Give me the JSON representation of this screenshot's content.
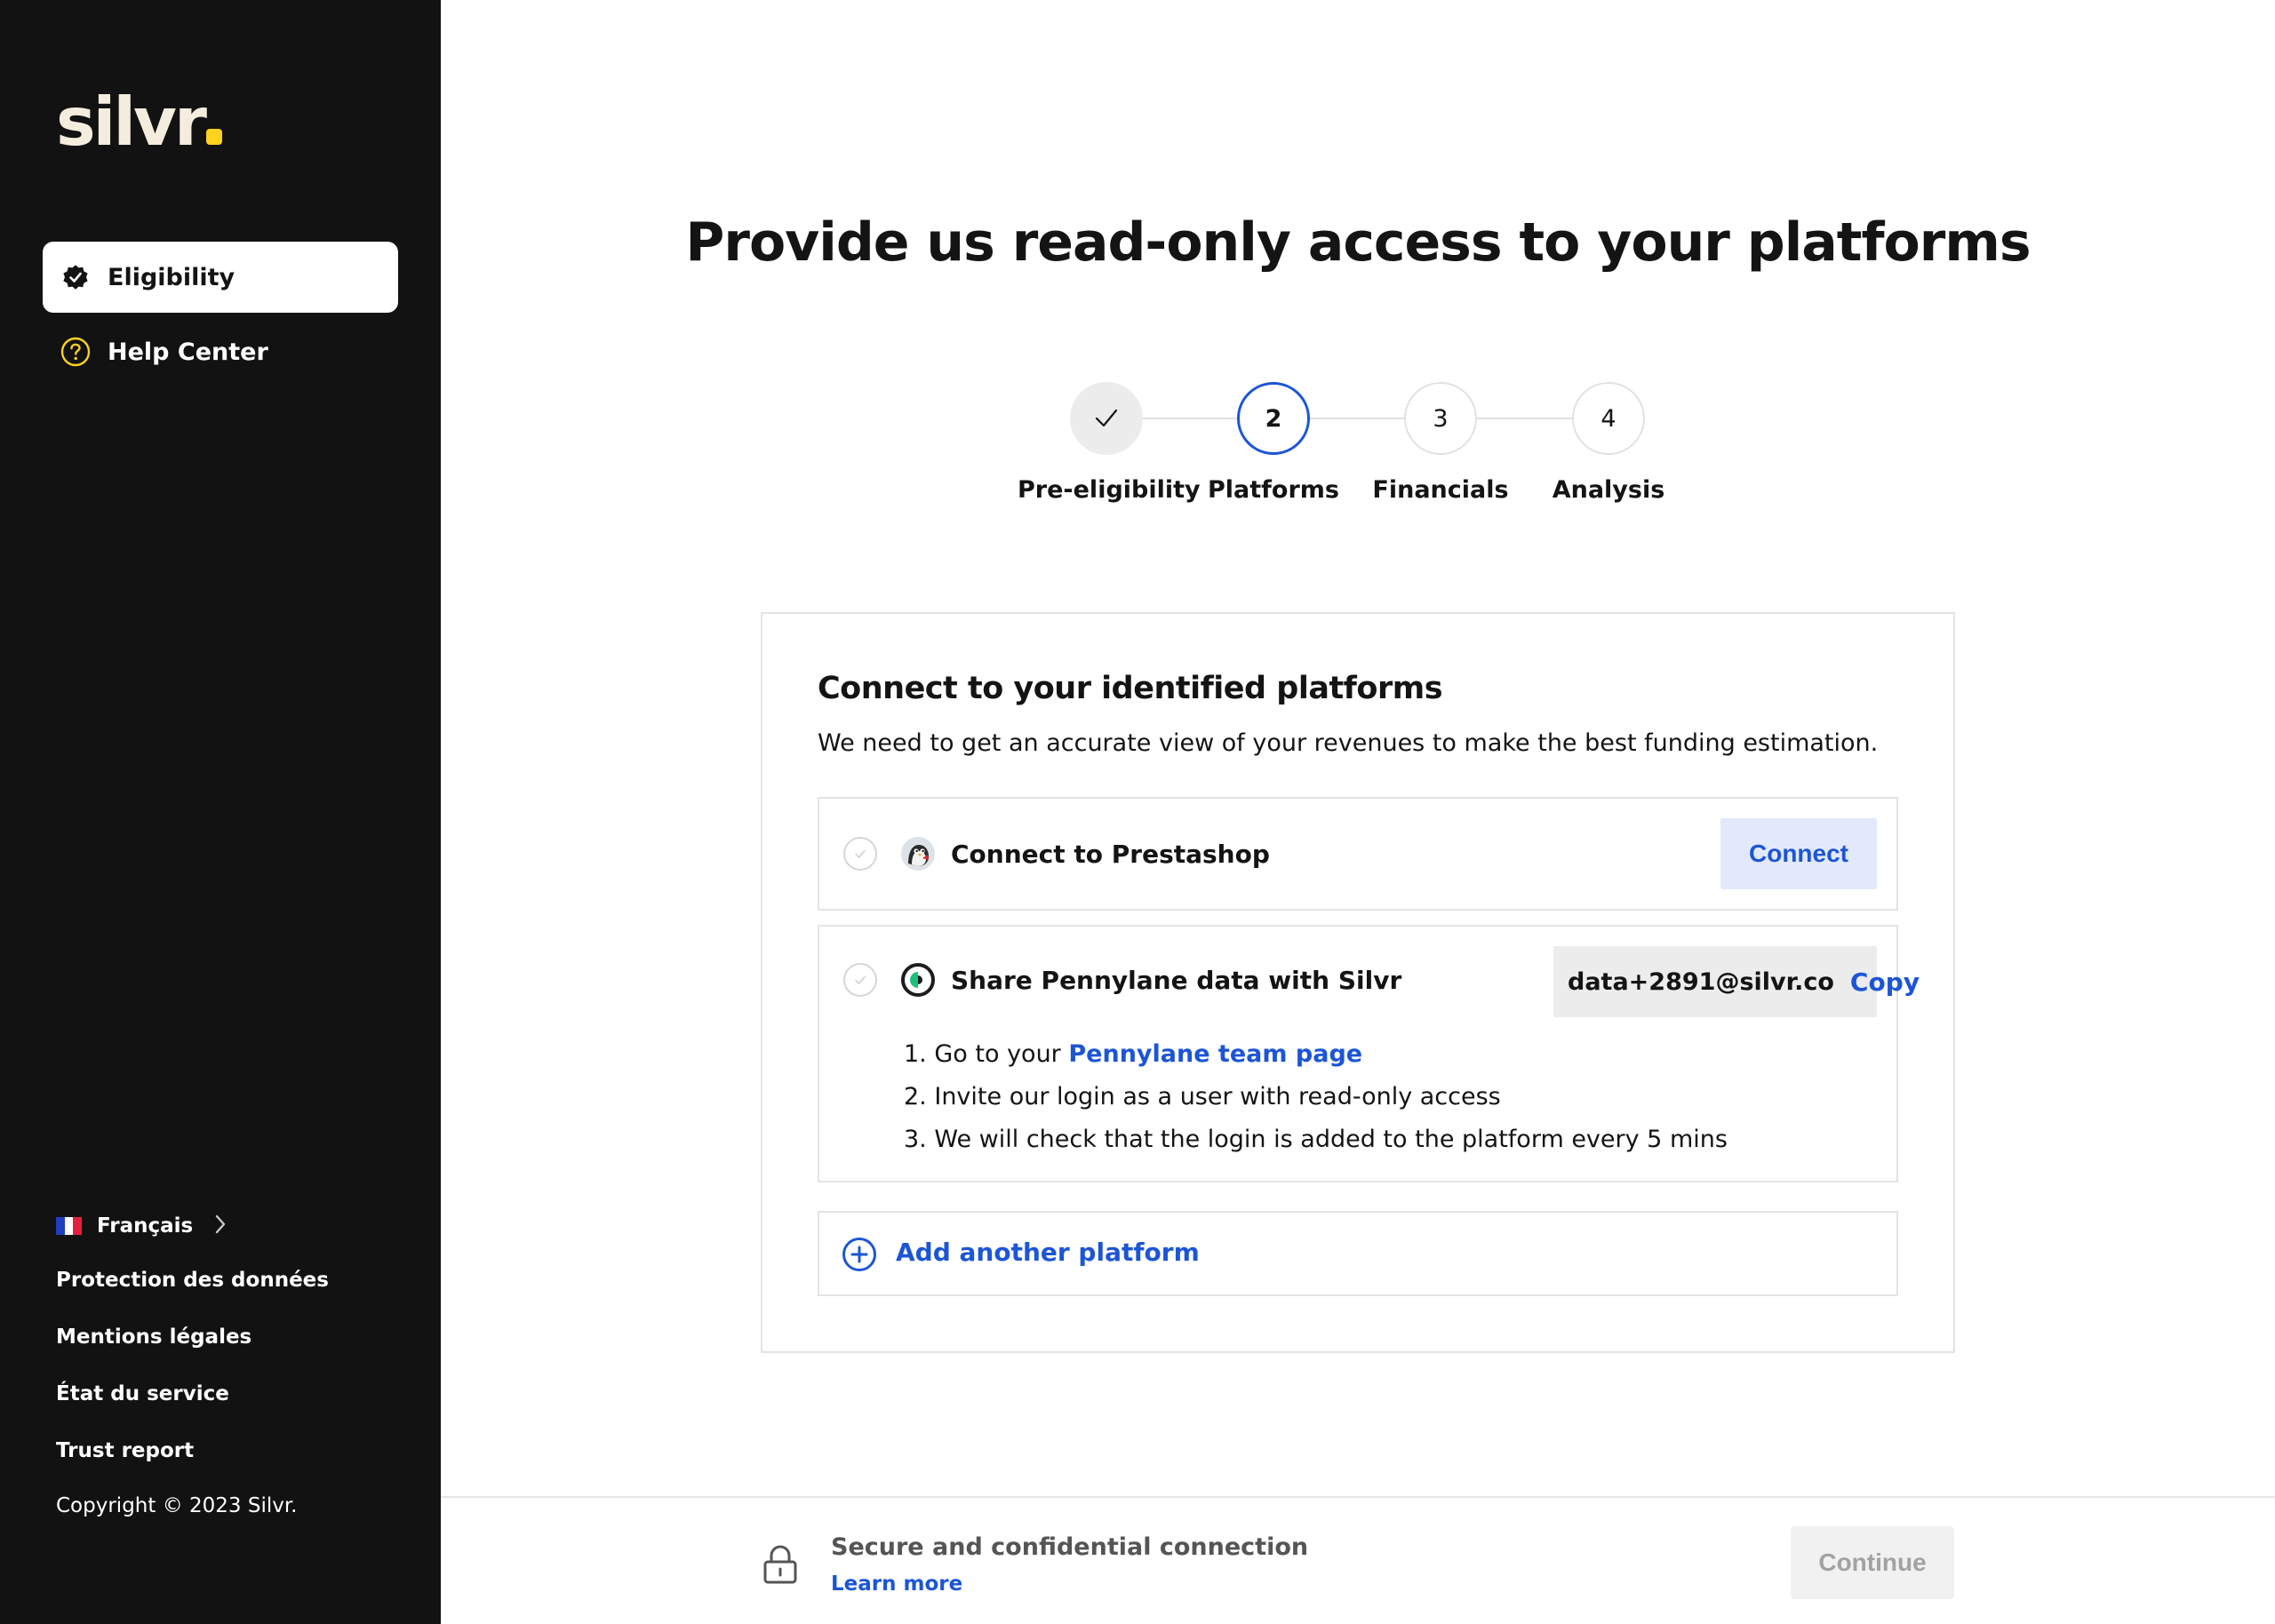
{
  "brand": {
    "logo_text": "silvr",
    "accent_color": "#ffd21f",
    "sidebar_bg": "#121212",
    "link_color": "#1c55d6"
  },
  "sidebar": {
    "items": [
      {
        "label": "Eligibility",
        "icon": "check-badge-icon",
        "active": true
      },
      {
        "label": "Help Center",
        "icon": "question-circle-icon",
        "active": false
      }
    ],
    "language": {
      "label": "Français",
      "flag": "france-flag-icon"
    },
    "links": [
      {
        "label": "Protection des données"
      },
      {
        "label": "Mentions légales"
      },
      {
        "label": "État du service"
      },
      {
        "label": "Trust report"
      }
    ],
    "copyright": "Copyright © 2023 Silvr."
  },
  "page": {
    "title": "Provide us read-only access to your platforms"
  },
  "stepper": {
    "steps": [
      {
        "number": "",
        "label": "Pre-eligibility",
        "state": "done"
      },
      {
        "number": "2",
        "label": "Platforms",
        "state": "current"
      },
      {
        "number": "3",
        "label": "Financials",
        "state": "upcoming"
      },
      {
        "number": "4",
        "label": "Analysis",
        "state": "upcoming"
      }
    ]
  },
  "card": {
    "title": "Connect to your identified platforms",
    "description": "We need to get an accurate view of your revenues to make the best funding estimation.",
    "platforms": [
      {
        "name": "Connect to Prestashop",
        "icon": "prestashop-icon",
        "action_label": "Connect"
      },
      {
        "name": "Share Pennylane data with Silvr",
        "icon": "pennylane-icon",
        "email": "data+2891@silvr.co",
        "copy_label": "Copy",
        "instructions": [
          {
            "num": "1.",
            "prefix": "Go to your ",
            "link": "Pennylane team page"
          },
          {
            "num": "2.",
            "text": "Invite our login as a user with read-only access"
          },
          {
            "num": "3.",
            "text": "We will check that the login is added to the platform every 5 mins"
          }
        ]
      }
    ],
    "add_platform_label": "Add another platform"
  },
  "footer": {
    "secure_text": "Secure and confidential connection",
    "learn_more": "Learn more",
    "continue_label": "Continue"
  }
}
